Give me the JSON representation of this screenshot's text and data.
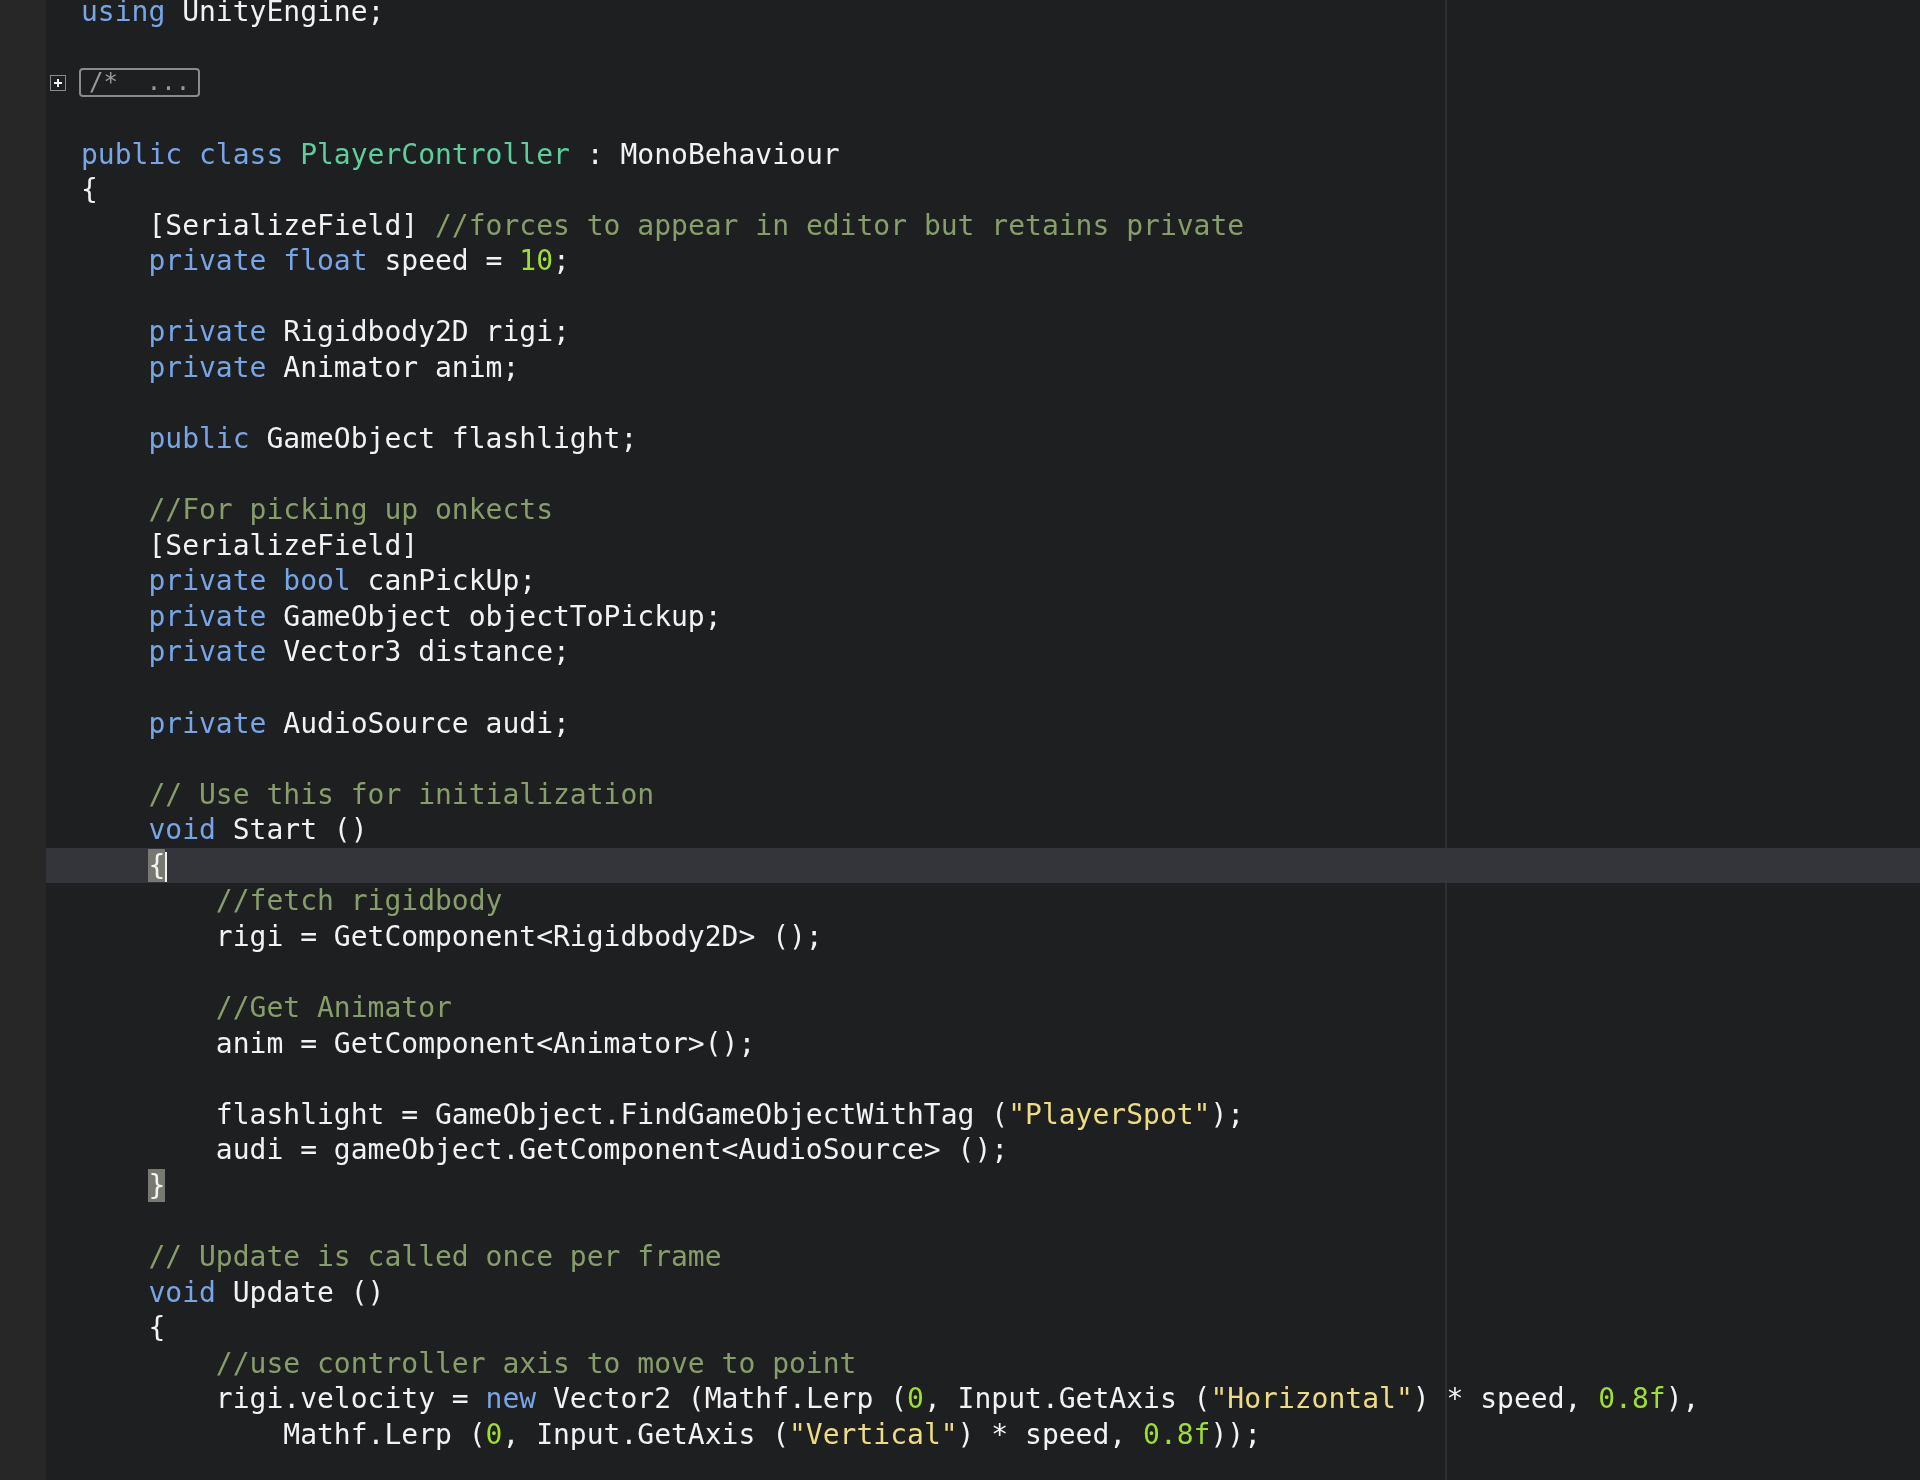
{
  "editor": {
    "lines": [
      {
        "current": false,
        "tokens": [
          {
            "kind": "keyword",
            "text": "using"
          },
          {
            "kind": "plain",
            "text": " UnityEngine;"
          }
        ]
      },
      {
        "current": false
      },
      {
        "current": false,
        "tokens": [
          {
            "kind": "fold",
            "text": "/*  ..."
          }
        ]
      },
      {
        "current": false
      },
      {
        "current": false,
        "tokens": [
          {
            "kind": "keyword",
            "text": "public class"
          },
          {
            "kind": "type",
            "text": " PlayerController"
          },
          {
            "kind": "plain",
            "text": " : MonoBehaviour"
          }
        ]
      },
      {
        "current": false,
        "tokens": [
          {
            "kind": "plain",
            "text": "{"
          }
        ]
      },
      {
        "current": false,
        "tokens": [
          {
            "kind": "plain",
            "text": "    [SerializeField] "
          },
          {
            "kind": "comment",
            "text": "//forces to appear in editor but retains private"
          }
        ]
      },
      {
        "current": false,
        "tokens": [
          {
            "kind": "keyword",
            "text": "    private float"
          },
          {
            "kind": "plain",
            "text": " speed = "
          },
          {
            "kind": "number",
            "text": "10"
          },
          {
            "kind": "plain",
            "text": ";"
          }
        ]
      },
      {
        "current": false
      },
      {
        "current": false,
        "tokens": [
          {
            "kind": "keyword",
            "text": "    private"
          },
          {
            "kind": "plain",
            "text": " Rigidbody2D rigi;"
          }
        ]
      },
      {
        "current": false,
        "tokens": [
          {
            "kind": "keyword",
            "text": "    private"
          },
          {
            "kind": "plain",
            "text": " Animator anim;"
          }
        ]
      },
      {
        "current": false
      },
      {
        "current": false,
        "tokens": [
          {
            "kind": "keyword",
            "text": "    public"
          },
          {
            "kind": "plain",
            "text": " GameObject flashlight;"
          }
        ]
      },
      {
        "current": false
      },
      {
        "current": false,
        "tokens": [
          {
            "kind": "comment",
            "text": "    //For picking up onkects"
          }
        ]
      },
      {
        "current": false,
        "tokens": [
          {
            "kind": "plain",
            "text": "    [SerializeField]"
          }
        ]
      },
      {
        "current": false,
        "tokens": [
          {
            "kind": "keyword",
            "text": "    private bool"
          },
          {
            "kind": "plain",
            "text": " canPickUp;"
          }
        ]
      },
      {
        "current": false,
        "tokens": [
          {
            "kind": "keyword",
            "text": "    private"
          },
          {
            "kind": "plain",
            "text": " GameObject objectToPickup;"
          }
        ]
      },
      {
        "current": false,
        "tokens": [
          {
            "kind": "keyword",
            "text": "    private"
          },
          {
            "kind": "plain",
            "text": " Vector3 distance;"
          }
        ]
      },
      {
        "current": false
      },
      {
        "current": false,
        "tokens": [
          {
            "kind": "keyword",
            "text": "    private"
          },
          {
            "kind": "plain",
            "text": " AudioSource audi;"
          }
        ]
      },
      {
        "current": false
      },
      {
        "current": false,
        "tokens": [
          {
            "kind": "comment",
            "text": "    // Use this for initialization"
          }
        ]
      },
      {
        "current": false,
        "tokens": [
          {
            "kind": "keyword",
            "text": "    void"
          },
          {
            "kind": "plain",
            "text": " Start ()"
          }
        ]
      },
      {
        "current": true,
        "cursor": true,
        "tokens": [
          {
            "kind": "brace-match",
            "text": "    {"
          }
        ]
      },
      {
        "current": false,
        "tokens": [
          {
            "kind": "comment",
            "text": "        //fetch rigidbody"
          }
        ]
      },
      {
        "current": false,
        "tokens": [
          {
            "kind": "plain",
            "text": "        rigi = GetComponent<Rigidbody2D> ();"
          }
        ]
      },
      {
        "current": false
      },
      {
        "current": false,
        "tokens": [
          {
            "kind": "comment",
            "text": "        //Get Animator"
          }
        ]
      },
      {
        "current": false,
        "tokens": [
          {
            "kind": "plain",
            "text": "        anim = GetComponent<Animator>();"
          }
        ]
      },
      {
        "current": false
      },
      {
        "current": false,
        "tokens": [
          {
            "kind": "plain",
            "text": "        flashlight = GameObject.FindGameObjectWithTag ("
          },
          {
            "kind": "string",
            "text": "\"PlayerSpot\""
          },
          {
            "kind": "plain",
            "text": ");"
          }
        ]
      },
      {
        "current": false,
        "tokens": [
          {
            "kind": "plain",
            "text": "        audi = gameObject.GetComponent<AudioSource> ();"
          }
        ]
      },
      {
        "current": false,
        "tokens": [
          {
            "kind": "brace-match",
            "text": "    }"
          }
        ]
      },
      {
        "current": false
      },
      {
        "current": false,
        "tokens": [
          {
            "kind": "comment",
            "text": "    // Update is called once per frame"
          }
        ]
      },
      {
        "current": false,
        "tokens": [
          {
            "kind": "keyword",
            "text": "    void"
          },
          {
            "kind": "plain",
            "text": " Update ()"
          }
        ]
      },
      {
        "current": false,
        "tokens": [
          {
            "kind": "plain",
            "text": "    {"
          }
        ]
      },
      {
        "current": false,
        "tokens": [
          {
            "kind": "comment",
            "text": "        //use controller axis to move to point"
          }
        ]
      },
      {
        "current": false,
        "tokens": [
          {
            "kind": "plain",
            "text": "        rigi.velocity = "
          },
          {
            "kind": "keyword",
            "text": "new"
          },
          {
            "kind": "plain",
            "text": " Vector2 (Mathf.Lerp ("
          },
          {
            "kind": "number",
            "text": "0"
          },
          {
            "kind": "plain",
            "text": ", Input.GetAxis ("
          },
          {
            "kind": "string",
            "text": "\"Horizontal\""
          },
          {
            "kind": "plain",
            "text": ") * speed, "
          },
          {
            "kind": "number",
            "text": "0.8f"
          },
          {
            "kind": "plain",
            "text": "),"
          }
        ]
      },
      {
        "current": false,
        "tokens": [
          {
            "kind": "plain",
            "text": "            Mathf.Lerp ("
          },
          {
            "kind": "number",
            "text": "0"
          },
          {
            "kind": "plain",
            "text": ", Input.GetAxis ("
          },
          {
            "kind": "string",
            "text": "\"Vertical\""
          },
          {
            "kind": "plain",
            "text": ") * speed, "
          },
          {
            "kind": "number",
            "text": "0.8f"
          },
          {
            "kind": "plain",
            "text": "));"
          }
        ]
      },
      {
        "current": false
      }
    ]
  }
}
